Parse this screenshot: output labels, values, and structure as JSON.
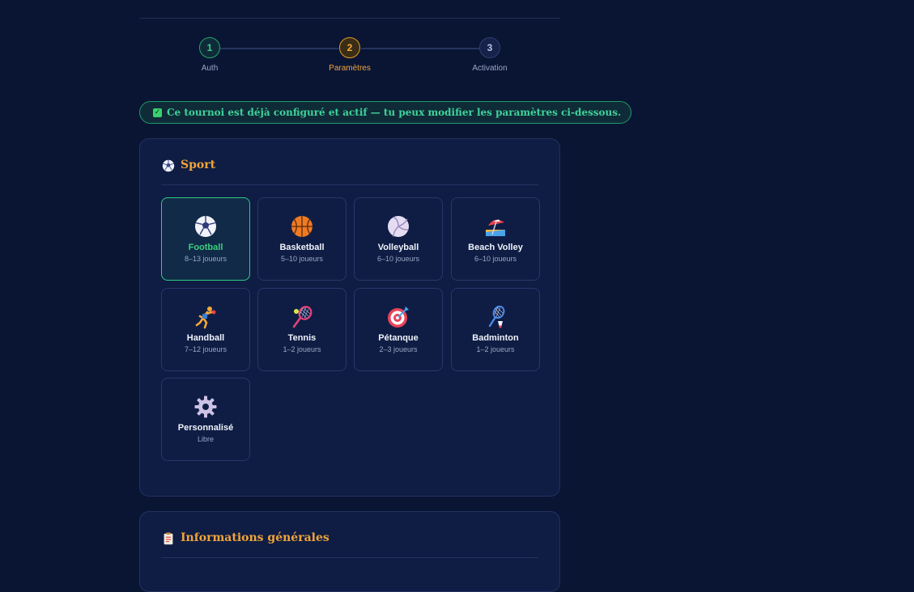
{
  "stepper": {
    "steps": [
      {
        "number": "1",
        "label": "Auth",
        "state": "done"
      },
      {
        "number": "2",
        "label": "Paramètres",
        "state": "active"
      },
      {
        "number": "3",
        "label": "Activation",
        "state": "todo"
      }
    ]
  },
  "banner": {
    "icon": "check-box-icon",
    "text": "Ce tournoi est déjà configuré et actif — tu peux modifier les paramètres ci-dessous."
  },
  "sport_section": {
    "icon": "soccer-ball-icon",
    "title": "Sport",
    "selected": "Football",
    "options": [
      {
        "name": "Football",
        "players": "8–13 joueurs",
        "icon": "soccer-ball-icon"
      },
      {
        "name": "Basketball",
        "players": "5–10 joueurs",
        "icon": "basketball-icon"
      },
      {
        "name": "Volleyball",
        "players": "6–10 joueurs",
        "icon": "volleyball-icon"
      },
      {
        "name": "Beach Volley",
        "players": "6–10 joueurs",
        "icon": "beach-umbrella-icon"
      },
      {
        "name": "Handball",
        "players": "7–12 joueurs",
        "icon": "handball-player-icon"
      },
      {
        "name": "Tennis",
        "players": "1–2 joueurs",
        "icon": "tennis-racket-icon"
      },
      {
        "name": "Pétanque",
        "players": "2–3 joueurs",
        "icon": "target-icon"
      },
      {
        "name": "Badminton",
        "players": "1–2 joueurs",
        "icon": "badminton-icon"
      },
      {
        "name": "Personnalisé",
        "players": "Libre",
        "icon": "gear-icon"
      }
    ]
  },
  "info_section": {
    "icon": "clipboard-icon",
    "title": "Informations générales"
  },
  "colors": {
    "background": "#0a1534",
    "accent": "#f0a43a",
    "success": "#3ccf7e"
  }
}
